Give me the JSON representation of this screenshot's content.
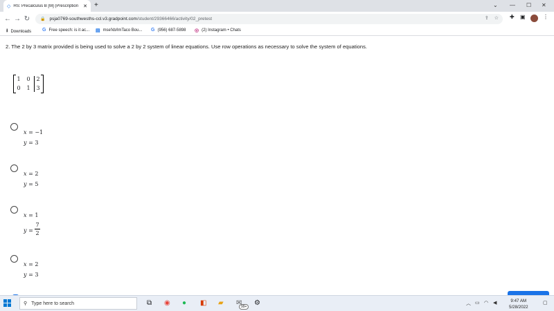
{
  "browser": {
    "tab_title": "HS: Precalculus B [M] (Prescription",
    "url_host": "psja0769-southwesths-ccl.v3.gradpoint.com",
    "url_path": "/student/29366466/activity/02_pretest",
    "bookmarks": [
      {
        "label": "Downloads",
        "icon": "download-icon"
      },
      {
        "label": "Free speech: is it ac...",
        "icon": "google-icon"
      },
      {
        "label": "mse'kb/lmTaco Bou...",
        "icon": "doc-icon"
      },
      {
        "label": "(956) 687-5898",
        "icon": "google-icon"
      },
      {
        "label": "(2) Instagram • Chats",
        "icon": "instagram-icon"
      }
    ]
  },
  "question": {
    "text": "2. The 2 by 3 matrix provided is being used to solve a 2 by 2 system of linear equations. Use row operations as necessary to solve the system of equations.",
    "matrix": [
      [
        "1",
        "0",
        "2"
      ],
      [
        "0",
        "1",
        "3"
      ]
    ]
  },
  "options": [
    {
      "x": "−1",
      "y": "3"
    },
    {
      "x": "2",
      "y": "5"
    },
    {
      "x": "1",
      "y_num": "7",
      "y_den": "2"
    },
    {
      "x": "2",
      "y": "3"
    }
  ],
  "equation_vars": {
    "x": "x",
    "y": "y",
    "eq": "="
  },
  "taskbar": {
    "search_placeholder": "Type here to search",
    "time": "9:47 AM",
    "date": "5/28/2022",
    "badge": "99+"
  }
}
